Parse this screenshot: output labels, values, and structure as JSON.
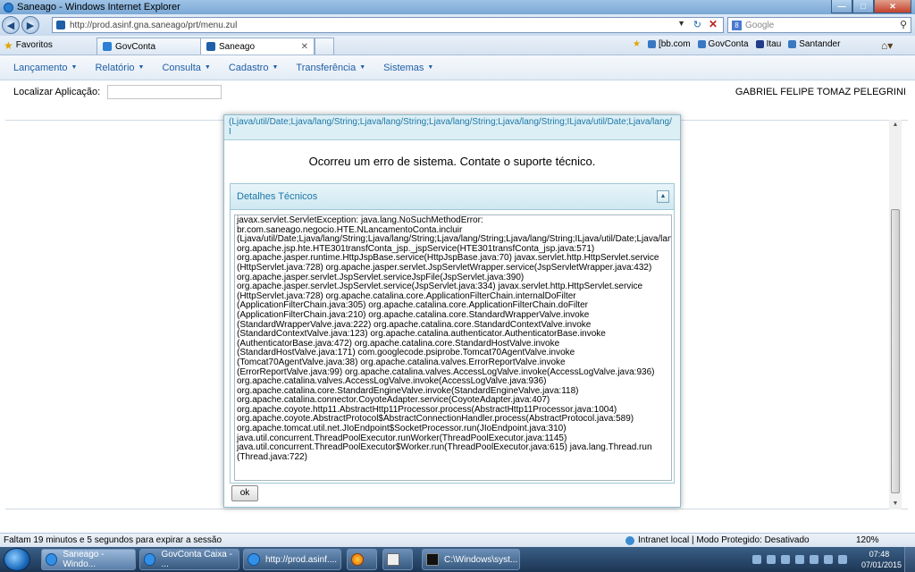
{
  "window": {
    "title": "Saneago - Windows Internet Explorer"
  },
  "address_bar": {
    "url": "http://prod.asinf.gna.saneago/prt/menu.zul",
    "search_placeholder": "Google"
  },
  "tabs": [
    {
      "label": "GovConta"
    },
    {
      "label": "Saneago"
    }
  ],
  "favorites": {
    "label": "Favoritos",
    "items": [
      "[bb.com",
      "GovConta",
      "Itau",
      "Santander"
    ]
  },
  "menu": {
    "items": [
      "Lançamento",
      "Relatório",
      "Consulta",
      "Cadastro",
      "Transferência",
      "Sistemas"
    ]
  },
  "locator": {
    "label": "Localizar Aplicação:",
    "value": "",
    "user": "GABRIEL FELIPE TOMAZ PELEGRINI"
  },
  "dialog": {
    "truncated_line": "(Ljava/util/Date;Ljava/lang/String;Ljava/lang/String;Ljava/lang/String;Ljava/lang/String;ILjava/util/Date;Ljava/lang/",
    "truncated_line_2": "I",
    "message": "Ocorreu um erro de sistema. Contate o suporte técnico.",
    "details_title": "Detalhes Técnicos",
    "trace": "javax.servlet.ServletException: java.lang.NoSuchMethodError: br.com.saneago.negocio.HTE.NLancamentoConta.incluir (Ljava/util/Date;Ljava/lang/String;Ljava/lang/String;Ljava/lang/String;Ljava/lang/String;ILjava/util/Date;Ljava/lang/String;I org.apache.jsp.hte.HTE301transfConta_jsp._jspService(HTE301transfConta_jsp.java:571) org.apache.jasper.runtime.HttpJspBase.service(HttpJspBase.java:70) javax.servlet.http.HttpServlet.service (HttpServlet.java:728) org.apache.jasper.servlet.JspServletWrapper.service(JspServletWrapper.java:432) org.apache.jasper.servlet.JspServlet.serviceJspFile(JspServlet.java:390) org.apache.jasper.servlet.JspServlet.service(JspServlet.java:334) javax.servlet.http.HttpServlet.service (HttpServlet.java:728) org.apache.catalina.core.ApplicationFilterChain.internalDoFilter (ApplicationFilterChain.java:305) org.apache.catalina.core.ApplicationFilterChain.doFilter (ApplicationFilterChain.java:210) org.apache.catalina.core.StandardWrapperValve.invoke (StandardWrapperValve.java:222) org.apache.catalina.core.StandardContextValve.invoke (StandardContextValve.java:123) org.apache.catalina.authenticator.AuthenticatorBase.invoke (AuthenticatorBase.java:472) org.apache.catalina.core.StandardHostValve.invoke (StandardHostValve.java:171) com.googlecode.psiprobe.Tomcat70AgentValve.invoke (Tomcat70AgentValve.java:38) org.apache.catalina.valves.ErrorReportValve.invoke (ErrorReportValve.java:99) org.apache.catalina.valves.AccessLogValve.invoke(AccessLogValve.java:936) org.apache.catalina.valves.AccessLogValve.invoke(AccessLogValve.java:936) org.apache.catalina.core.StandardEngineValve.invoke(StandardEngineValve.java:118) org.apache.catalina.connector.CoyoteAdapter.service(CoyoteAdapter.java:407) org.apache.coyote.http11.AbstractHttp11Processor.process(AbstractHttp11Processor.java:1004) org.apache.coyote.AbstractProtocol$AbstractConnectionHandler.process(AbstractProtocol.java:589) org.apache.tomcat.util.net.JIoEndpoint$SocketProcessor.run(JIoEndpoint.java:310) java.util.concurrent.ThreadPoolExecutor.runWorker(ThreadPoolExecutor.java:1145) java.util.concurrent.ThreadPoolExecutor$Worker.run(ThreadPoolExecutor.java:615) java.lang.Thread.run (Thread.java:722)",
    "ok_label": "ok"
  },
  "status": {
    "message": "Faltam 19 minutos e 5 segundos para expirar a sessão",
    "zone": "Intranet local | Modo Protegido: Desativado",
    "zoom": "120%"
  },
  "taskbar": {
    "items": [
      "Saneago - Windo...",
      "GovConta Caixa - ...",
      "http://prod.asinf....",
      "C:\\Windows\\syst..."
    ],
    "time": "07:48",
    "date": "07/01/2015"
  },
  "colors": {
    "menu_link": "#1f5fa6",
    "dialog_accent": "#1d78a8",
    "close_button": "#c4402a"
  },
  "icons": [
    "ie-icon",
    "back-icon",
    "forward-icon",
    "refresh-icon",
    "stop-icon",
    "search-icon",
    "star-icon",
    "home-icon",
    "collapse-icon",
    "start-orb-icon",
    "firefox-icon",
    "cmd-icon"
  ]
}
